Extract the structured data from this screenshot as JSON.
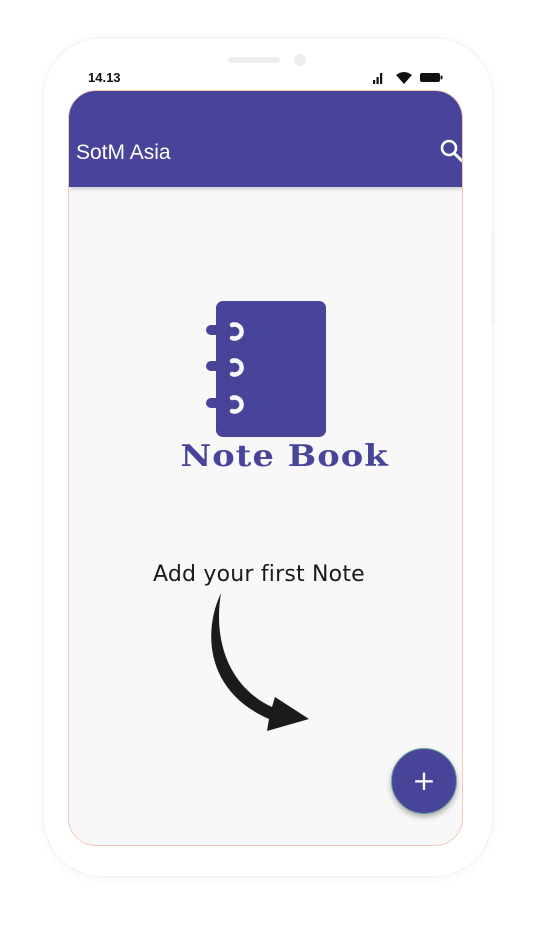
{
  "status_bar": {
    "time": "14.13",
    "icons": [
      "signal-icon",
      "wifi-icon",
      "battery-icon"
    ]
  },
  "app_bar": {
    "title": "SotM Asia",
    "search_icon": "search-icon",
    "background": "#474499"
  },
  "empty_state": {
    "logo_icon": "notebook-icon",
    "logo_text": "Note Book",
    "message": "Add your first Note",
    "arrow_icon": "curved-arrow-icon"
  },
  "fab": {
    "icon": "plus-icon",
    "label": "+",
    "color": "#474499"
  },
  "colors": {
    "accent": "#474499",
    "screen_bg": "#f8f8f9"
  }
}
